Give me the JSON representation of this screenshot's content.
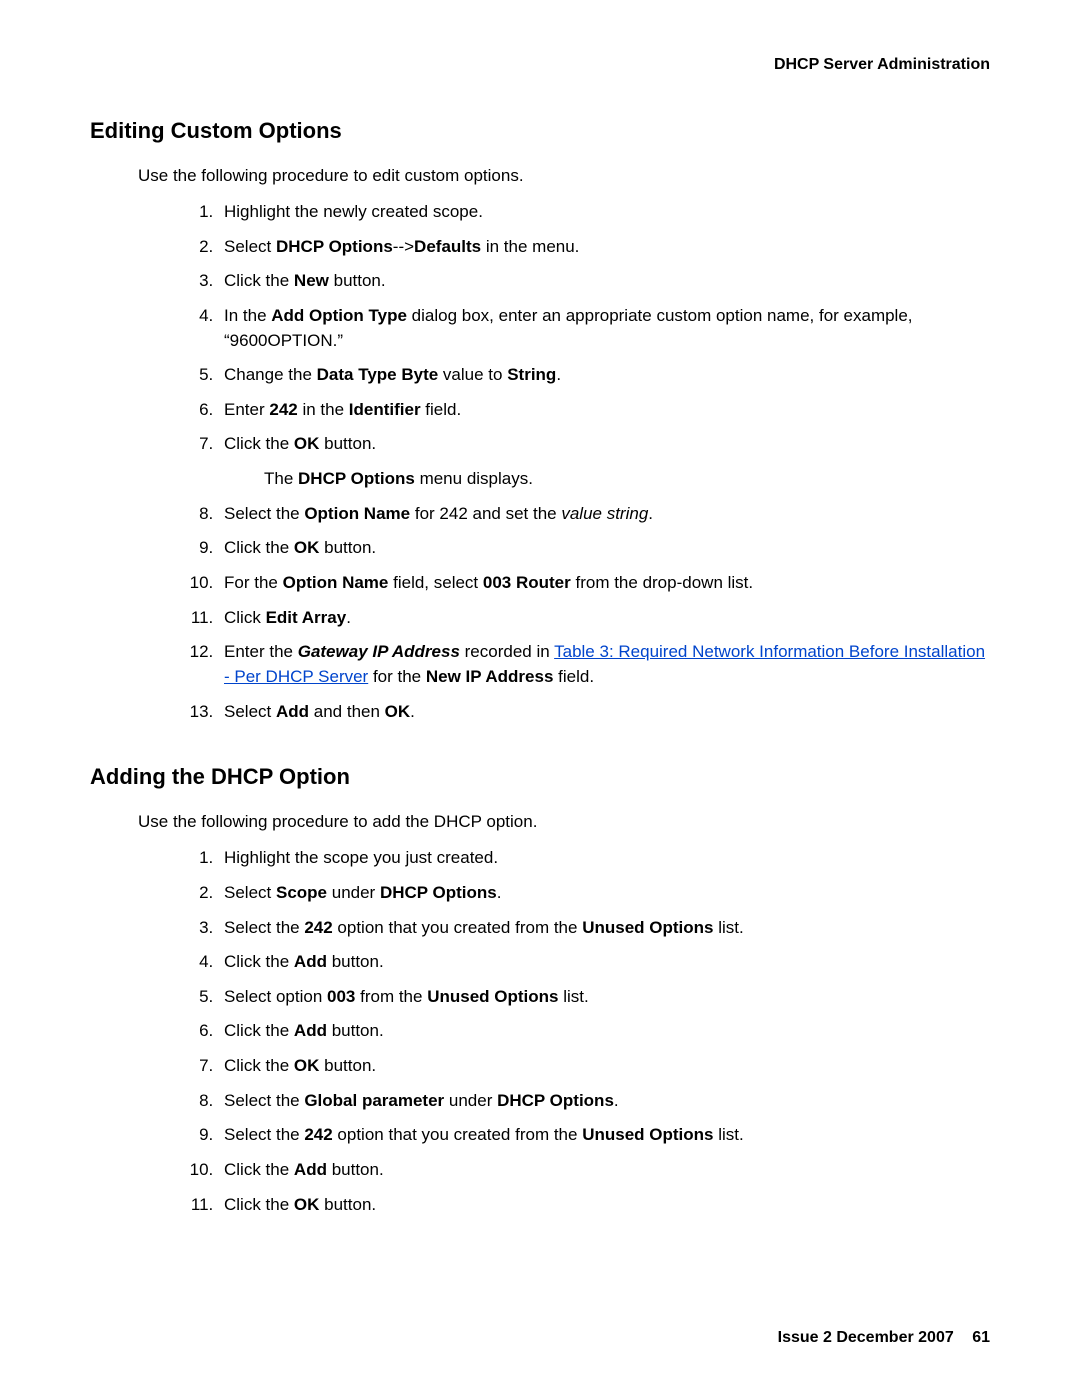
{
  "header": {
    "title": "DHCP Server Administration"
  },
  "section1": {
    "heading": "Editing Custom Options",
    "intro": "Use the following procedure to edit custom options.",
    "steps": {
      "s1": "Highlight the newly created scope.",
      "s2a": "Select ",
      "s2b": "DHCP Options",
      "s2c": "-->",
      "s2d": "Defaults",
      "s2e": " in the menu.",
      "s3a": "Click the ",
      "s3b": "New",
      "s3c": " button.",
      "s4a": "In the ",
      "s4b": "Add Option Type",
      "s4c": " dialog box, enter an appropriate custom option name, for example, “9600OPTION.”",
      "s5a": "Change the ",
      "s5b": "Data Type Byte",
      "s5c": " value to ",
      "s5d": "String",
      "s5e": ".",
      "s6a": "Enter ",
      "s6b": "242",
      "s6c": " in the ",
      "s6d": "Identifier",
      "s6e": " field.",
      "s7a": "Click the ",
      "s7b": "OK",
      "s7c": " button.",
      "s7suba": "The ",
      "s7subb": "DHCP Options",
      "s7subc": " menu displays.",
      "s8a": "Select the ",
      "s8b": "Option Name",
      "s8c": " for 242 and set the ",
      "s8d": "value string",
      "s8e": ".",
      "s9a": "Click the ",
      "s9b": "OK",
      "s9c": " button.",
      "s10a": "For the ",
      "s10b": "Option Name",
      "s10c": " field, select ",
      "s10d": "003 Router",
      "s10e": " from the drop-down list.",
      "s11a": "Click ",
      "s11b": "Edit Array",
      "s11c": ".",
      "s12a": "Enter the ",
      "s12b": "Gateway IP Address",
      "s12c": " recorded in ",
      "s12link": "Table 3:  Required Network Information Before Installation - Per DHCP Server",
      "s12d": " for the ",
      "s12e": "New IP Address",
      "s12f": " field.",
      "s13a": "Select ",
      "s13b": "Add",
      "s13c": " and then ",
      "s13d": "OK",
      "s13e": "."
    }
  },
  "section2": {
    "heading": "Adding the DHCP Option",
    "intro": "Use the following procedure to add the DHCP option.",
    "steps": {
      "s1": "Highlight the scope you just created.",
      "s2a": "Select ",
      "s2b": "Scope",
      "s2c": " under ",
      "s2d": "DHCP Options",
      "s2e": ".",
      "s3a": "Select the ",
      "s3b": "242",
      "s3c": " option that you created from the ",
      "s3d": "Unused Options",
      "s3e": " list.",
      "s4a": "Click the ",
      "s4b": "Add",
      "s4c": " button.",
      "s5a": "Select option ",
      "s5b": "003",
      "s5c": " from the ",
      "s5d": "Unused Options",
      "s5e": " list.",
      "s6a": "Click the ",
      "s6b": "Add",
      "s6c": " button.",
      "s7a": "Click the ",
      "s7b": "OK",
      "s7c": " button.",
      "s8a": "Select the ",
      "s8b": "Global parameter",
      "s8c": " under ",
      "s8d": "DHCP Options",
      "s8e": ".",
      "s9a": "Select the ",
      "s9b": "242",
      "s9c": " option that you created from the ",
      "s9d": "Unused Options",
      "s9e": " list.",
      "s10a": "Click the ",
      "s10b": "Add",
      "s10c": " button.",
      "s11a": "Click the ",
      "s11b": "OK",
      "s11c": " button."
    }
  },
  "footer": {
    "issue": "Issue 2   December 2007",
    "page": "61"
  }
}
